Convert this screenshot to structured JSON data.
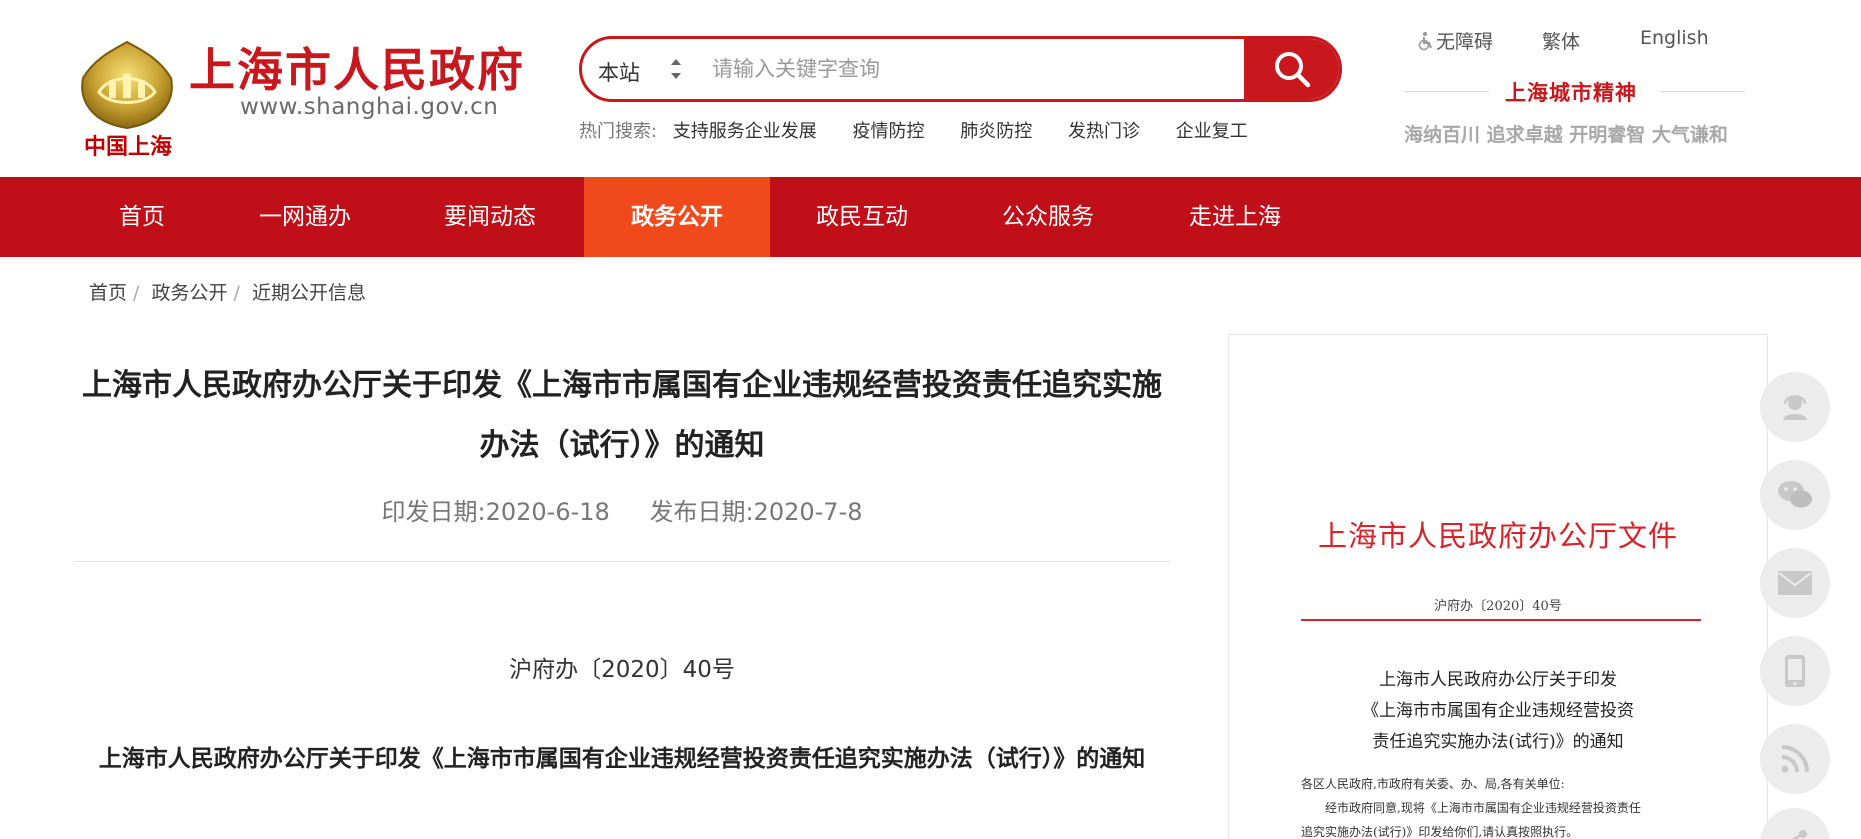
{
  "header": {
    "logo_sub": "中国上海",
    "logo_title": "上海市人民政府",
    "logo_url": "www.shanghai.gov.cn",
    "search": {
      "scope": "本站",
      "placeholder": "请输入关键字查询"
    },
    "hot_label": "热门搜索:",
    "hot_items": [
      "支持服务企业发展",
      "疫情防控",
      "肺炎防控",
      "发热门诊",
      "企业复工"
    ],
    "top_links": {
      "accessibility": "无障碍",
      "traditional": "繁体",
      "english": "English"
    },
    "spirit_title": "上海城市精神",
    "spirit_sub": "海纳百川 追求卓越 开明睿智 大气谦和"
  },
  "nav": {
    "items": [
      "首页",
      "一网通办",
      "要闻动态",
      "政务公开",
      "政民互动",
      "公众服务",
      "走进上海"
    ],
    "active": "政务公开"
  },
  "breadcrumb": [
    "首页",
    "政务公开",
    "近期公开信息"
  ],
  "article": {
    "title": "上海市人民政府办公厅关于印发《上海市市属国有企业违规经营投资责任追究实施办法（试行）》的通知",
    "issue_date_label": "印发日期:",
    "issue_date": "2020-6-18",
    "publish_date_label": "发布日期:",
    "publish_date": "2020-7-8",
    "doc_number": "沪府办〔2020〕40号",
    "sub_title": "上海市人民政府办公厅关于印发《上海市市属国有企业违规经营投资责任追究实施办法（试行）》的通知"
  },
  "doc_preview": {
    "head": "上海市人民政府办公厅文件",
    "number": "沪府办〔2020〕40号",
    "title_lines": [
      "上海市人民政府办公厅关于印发",
      "《上海市市属国有企业违规经营投资",
      "责任追究实施办法(试行)》的通知"
    ],
    "body_lines": [
      "各区人民政府,市政府有关委、办、局,各有关单位:",
      "　　经市政府同意,现将《上海市市属国有企业违规经营投资责任",
      "追究实施办法(试行)》印发给你们,请认真按照执行。"
    ]
  },
  "float_tools": [
    "service-icon",
    "wechat-icon",
    "mail-icon",
    "mobile-icon",
    "rss-icon",
    "share-icon"
  ],
  "colors": {
    "brand_red": "#c8171d",
    "nav_red": "#c00f18",
    "nav_active": "#f04a1c"
  }
}
